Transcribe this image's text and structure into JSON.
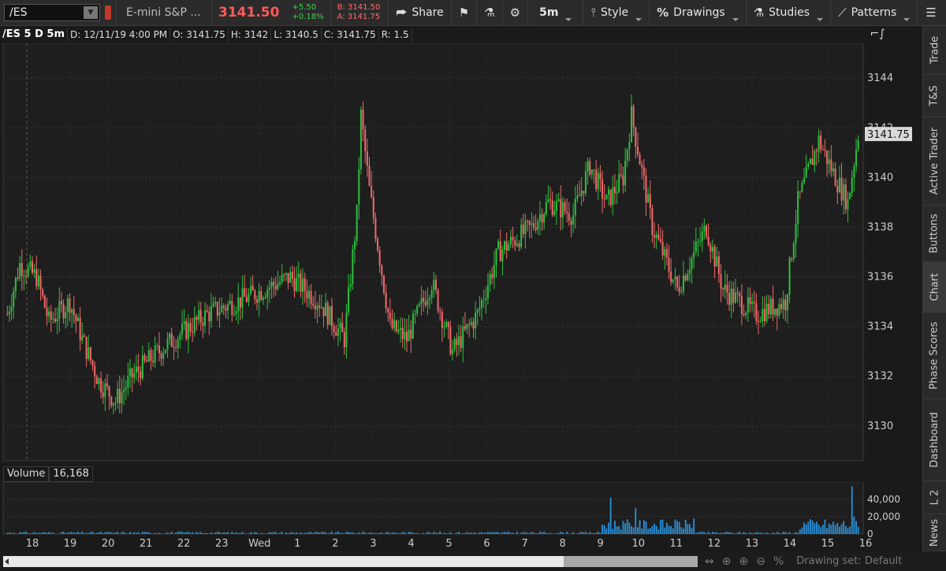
{
  "toolbar": {
    "symbol": "/ES",
    "description": "E-mini S&P ...",
    "last_price": "3141.50",
    "change": "+5.50",
    "change_pct": "+0.18%",
    "bid": "B: 3141.50",
    "ask": "A: 3141.75",
    "share_label": "Share",
    "timeframe_label": "5m",
    "style_label": "Style",
    "drawings_label": "Drawings",
    "studies_label": "Studies",
    "patterns_label": "Patterns"
  },
  "header": {
    "symbol_period": "/ES 5 D 5m",
    "date": "D: 12/11/19 4:00 PM",
    "open": "O: 3141.75",
    "high": "H: 3142",
    "low": "L: 3140.5",
    "close": "C: 3141.75",
    "range": "R: 1.5"
  },
  "volume_panel": {
    "label": "Volume",
    "value": "16,168"
  },
  "bottom": {
    "drawing_set": "Drawing set: Default"
  },
  "sidebar": {
    "tabs": [
      "Trade",
      "T&S",
      "Active Trader",
      "Buttons",
      "Chart",
      "Phase Scores",
      "Dashboard",
      "L 2",
      "News"
    ],
    "active": "Chart"
  },
  "colors": {
    "up": "#2fbf3f",
    "down": "#f06a6a",
    "background": "#1a1a1a",
    "price_label_bg": "#d9d9d9",
    "volume": "#2a8fd6"
  },
  "chart_data": {
    "type": "candlestick",
    "symbol": "/ES",
    "current_price": 3141.75,
    "ylim": [
      3128.6,
      3145.4
    ],
    "yticks": [
      3130,
      3132,
      3134,
      3136,
      3138,
      3140,
      3142,
      3144
    ],
    "x_labels": [
      "18",
      "19",
      "20",
      "21",
      "22",
      "23",
      "Wed",
      "1",
      "2",
      "3",
      "4",
      "5",
      "6",
      "7",
      "8",
      "9",
      "10",
      "11",
      "12",
      "13",
      "14",
      "15",
      "16"
    ],
    "volume_ticks": [
      "40,000",
      "20,000",
      "0"
    ],
    "volume_ylim": [
      0,
      60000
    ],
    "price_path_anchors": [
      [
        0,
        3134.5
      ],
      [
        6,
        3136.5
      ],
      [
        14,
        3136.0
      ],
      [
        20,
        3134.2
      ],
      [
        30,
        3135.0
      ],
      [
        36,
        3133.5
      ],
      [
        44,
        3131.8
      ],
      [
        52,
        3131.0
      ],
      [
        60,
        3132.0
      ],
      [
        70,
        3132.8
      ],
      [
        80,
        3133.5
      ],
      [
        96,
        3134.5
      ],
      [
        116,
        3135.2
      ],
      [
        136,
        3136.0
      ],
      [
        150,
        3135.0
      ],
      [
        162,
        3133.5
      ],
      [
        168,
        3138.5
      ],
      [
        170,
        3142.5
      ],
      [
        174,
        3139.5
      ],
      [
        184,
        3134.0
      ],
      [
        192,
        3133.5
      ],
      [
        204,
        3135.8
      ],
      [
        214,
        3133.0
      ],
      [
        226,
        3134.5
      ],
      [
        236,
        3137.0
      ],
      [
        252,
        3138.0
      ],
      [
        260,
        3139.0
      ],
      [
        272,
        3138.5
      ],
      [
        280,
        3140.5
      ],
      [
        288,
        3139.0
      ],
      [
        296,
        3140.0
      ],
      [
        300,
        3142.5
      ],
      [
        310,
        3138.0
      ],
      [
        322,
        3135.5
      ],
      [
        336,
        3138.0
      ],
      [
        344,
        3135.5
      ],
      [
        360,
        3134.5
      ],
      [
        374,
        3135.0
      ],
      [
        380,
        3139.0
      ],
      [
        390,
        3141.5
      ],
      [
        398,
        3140.0
      ],
      [
        404,
        3139.0
      ],
      [
        409,
        3141.75
      ]
    ],
    "volume_spikes": [
      [
        290,
        42000
      ],
      [
        302,
        30000
      ],
      [
        330,
        18000
      ],
      [
        406,
        55000
      ],
      [
        407,
        20000
      ],
      [
        408,
        15000
      ]
    ]
  }
}
